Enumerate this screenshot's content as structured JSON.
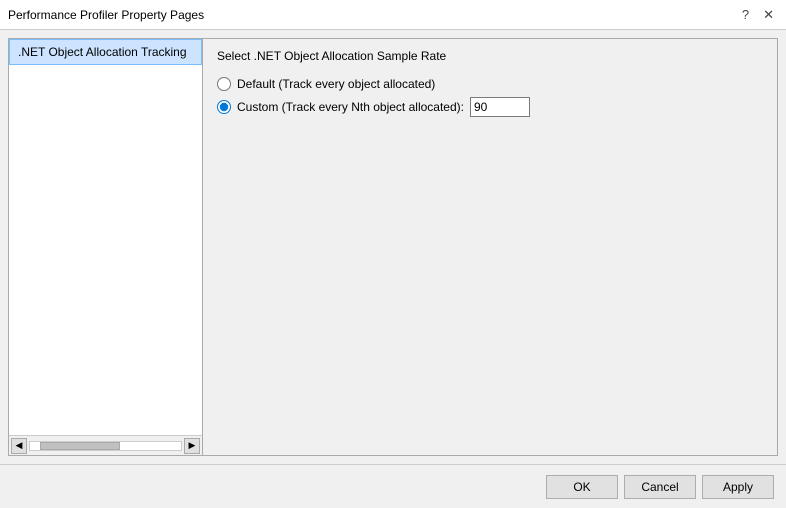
{
  "titleBar": {
    "title": "Performance Profiler Property Pages",
    "helpBtn": "?",
    "closeBtn": "✕"
  },
  "leftPanel": {
    "items": [
      {
        "label": ".NET Object Allocation Tracking"
      }
    ]
  },
  "rightPanel": {
    "sectionTitle": "Select .NET Object Allocation Sample Rate",
    "radioOptions": [
      {
        "id": "radio-default",
        "label": "Default (Track every object allocated)",
        "checked": false
      },
      {
        "id": "radio-custom",
        "label": "Custom (Track every Nth object allocated):",
        "checked": true
      }
    ],
    "customValue": "90"
  },
  "bottomBar": {
    "okLabel": "OK",
    "cancelLabel": "Cancel",
    "applyLabel": "Apply"
  }
}
